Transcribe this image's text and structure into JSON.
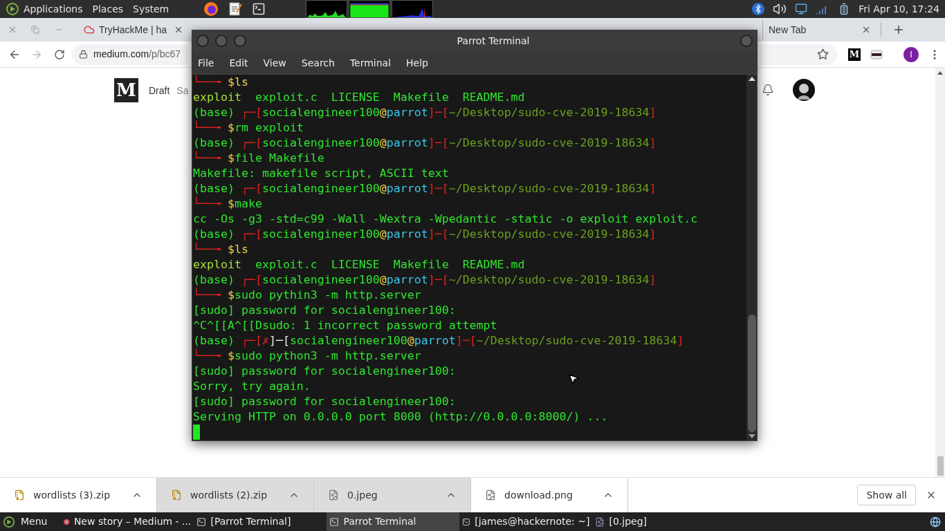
{
  "top_panel": {
    "menus": [
      "Applications",
      "Places",
      "System"
    ],
    "clock": "Fri Apr 10, 17:24"
  },
  "browser": {
    "tabs": [
      {
        "title": "TryHackMe | ha",
        "selected": false
      },
      {
        "title": "New Tab",
        "selected": false
      }
    ],
    "address": {
      "host": "medium.com",
      "path": "/p/bc67"
    },
    "extension_label": "M",
    "profile_initial": "I",
    "page": {
      "logo": "M",
      "status": "Draft",
      "saved": "Sa"
    },
    "downloads": [
      {
        "name": "wordlists (3).zip",
        "kind": "archive",
        "selected": false
      },
      {
        "name": "wordlists (2).zip",
        "kind": "archive",
        "selected": true
      },
      {
        "name": "0.jpeg",
        "kind": "image",
        "selected": true
      },
      {
        "name": "download.png",
        "kind": "image",
        "selected": false
      }
    ],
    "show_all": "Show all"
  },
  "terminal": {
    "title": "Parrot Terminal",
    "menus": [
      "File",
      "Edit",
      "View",
      "Search",
      "Terminal",
      "Help"
    ],
    "lines": [
      [
        {
          "text": "└──╼ ",
          "kind": "frame"
        },
        {
          "text": "$ls",
          "kind": "sign"
        }
      ],
      [
        {
          "text": "exploit",
          "kind": "exec"
        },
        {
          "text": "  exploit.c  LICENSE  Makefile  README.md",
          "kind": "text"
        }
      ],
      [
        {
          "text": "(base) ",
          "kind": "text"
        },
        {
          "text": "┌─[",
          "kind": "frame"
        },
        {
          "text": "socialengineer100",
          "kind": "text"
        },
        {
          "text": "@",
          "kind": "sign"
        },
        {
          "text": "parrot",
          "kind": "host"
        },
        {
          "text": "]─[",
          "kind": "frame"
        },
        {
          "text": "~/Desktop/sudo-cve-2019-18634",
          "kind": "path"
        },
        {
          "text": "]",
          "kind": "frame"
        }
      ],
      [
        {
          "text": "└──╼ ",
          "kind": "frame"
        },
        {
          "text": "$",
          "kind": "sign"
        },
        {
          "text": "rm exploit",
          "kind": "text"
        }
      ],
      [
        {
          "text": "(base) ",
          "kind": "text"
        },
        {
          "text": "┌─[",
          "kind": "frame"
        },
        {
          "text": "socialengineer100",
          "kind": "text"
        },
        {
          "text": "@",
          "kind": "sign"
        },
        {
          "text": "parrot",
          "kind": "host"
        },
        {
          "text": "]─[",
          "kind": "frame"
        },
        {
          "text": "~/Desktop/sudo-cve-2019-18634",
          "kind": "path"
        },
        {
          "text": "]",
          "kind": "frame"
        }
      ],
      [
        {
          "text": "└──╼ ",
          "kind": "frame"
        },
        {
          "text": "$",
          "kind": "sign"
        },
        {
          "text": "file Makefile",
          "kind": "text"
        }
      ],
      [
        {
          "text": "Makefile: makefile script, ASCII text",
          "kind": "text"
        }
      ],
      [
        {
          "text": "(base) ",
          "kind": "text"
        },
        {
          "text": "┌─[",
          "kind": "frame"
        },
        {
          "text": "socialengineer100",
          "kind": "text"
        },
        {
          "text": "@",
          "kind": "sign"
        },
        {
          "text": "parrot",
          "kind": "host"
        },
        {
          "text": "]─[",
          "kind": "frame"
        },
        {
          "text": "~/Desktop/sudo-cve-2019-18634",
          "kind": "path"
        },
        {
          "text": "]",
          "kind": "frame"
        }
      ],
      [
        {
          "text": "└──╼ ",
          "kind": "frame"
        },
        {
          "text": "$",
          "kind": "sign"
        },
        {
          "text": "make",
          "kind": "text"
        }
      ],
      [
        {
          "text": "cc -Os -g3 -std=c99 -Wall -Wextra -Wpedantic -static -o exploit exploit.c",
          "kind": "text"
        }
      ],
      [
        {
          "text": "(base) ",
          "kind": "text"
        },
        {
          "text": "┌─[",
          "kind": "frame"
        },
        {
          "text": "socialengineer100",
          "kind": "text"
        },
        {
          "text": "@",
          "kind": "sign"
        },
        {
          "text": "parrot",
          "kind": "host"
        },
        {
          "text": "]─[",
          "kind": "frame"
        },
        {
          "text": "~/Desktop/sudo-cve-2019-18634",
          "kind": "path"
        },
        {
          "text": "]",
          "kind": "frame"
        }
      ],
      [
        {
          "text": "└──╼ ",
          "kind": "frame"
        },
        {
          "text": "$ls",
          "kind": "sign"
        }
      ],
      [
        {
          "text": "exploit",
          "kind": "exec"
        },
        {
          "text": "  exploit.c  LICENSE  Makefile  README.md",
          "kind": "text"
        }
      ],
      [
        {
          "text": "(base) ",
          "kind": "text"
        },
        {
          "text": "┌─[",
          "kind": "frame"
        },
        {
          "text": "socialengineer100",
          "kind": "text"
        },
        {
          "text": "@",
          "kind": "sign"
        },
        {
          "text": "parrot",
          "kind": "host"
        },
        {
          "text": "]─[",
          "kind": "frame"
        },
        {
          "text": "~/Desktop/sudo-cve-2019-18634",
          "kind": "path"
        },
        {
          "text": "]",
          "kind": "frame"
        }
      ],
      [
        {
          "text": "└──╼ ",
          "kind": "frame"
        },
        {
          "text": "$",
          "kind": "sign"
        },
        {
          "text": "sudo pythin3 -m http.server",
          "kind": "text"
        }
      ],
      [
        {
          "text": "[sudo] password for socialengineer100:",
          "kind": "text"
        }
      ],
      [
        {
          "text": "^C^[[A^[[Dsudo: 1 incorrect password attempt",
          "kind": "text"
        }
      ],
      [
        {
          "text": "(base) ",
          "kind": "text"
        },
        {
          "text": "┌─[",
          "kind": "frame"
        },
        {
          "text": "✗",
          "kind": "frame"
        },
        {
          "text": "]─[",
          "kind": "plain"
        },
        {
          "text": "socialengineer100",
          "kind": "text"
        },
        {
          "text": "@",
          "kind": "sign"
        },
        {
          "text": "parrot",
          "kind": "host"
        },
        {
          "text": "]─[",
          "kind": "frame"
        },
        {
          "text": "~/Desktop/sudo-cve-2019-18634",
          "kind": "path"
        },
        {
          "text": "]",
          "kind": "frame"
        }
      ],
      [
        {
          "text": "└──╼ ",
          "kind": "frame"
        },
        {
          "text": "$",
          "kind": "sign"
        },
        {
          "text": "sudo python3 -m http.server",
          "kind": "text"
        }
      ],
      [
        {
          "text": "[sudo] password for socialengineer100:",
          "kind": "text"
        }
      ],
      [
        {
          "text": "Sorry, try again.",
          "kind": "text"
        }
      ],
      [
        {
          "text": "[sudo] password for socialengineer100:",
          "kind": "text"
        }
      ],
      [
        {
          "text": "Serving HTTP on 0.0.0.0 port 8000 (http://0.0.0.0:8000/) ...",
          "kind": "text"
        }
      ]
    ]
  },
  "taskbar": {
    "menu": "Menu",
    "windows": [
      {
        "title": "New story – Medium - ...",
        "kind": "browser",
        "selected": false
      },
      {
        "title": "[Parrot Terminal]",
        "kind": "terminal",
        "selected": false
      },
      {
        "title": "Parrot Terminal",
        "kind": "terminal",
        "selected": true
      },
      {
        "title": "[james@hackernote: ~]",
        "kind": "terminal",
        "selected": false
      },
      {
        "title": "[0.jpeg]",
        "kind": "image",
        "selected": false
      }
    ]
  }
}
